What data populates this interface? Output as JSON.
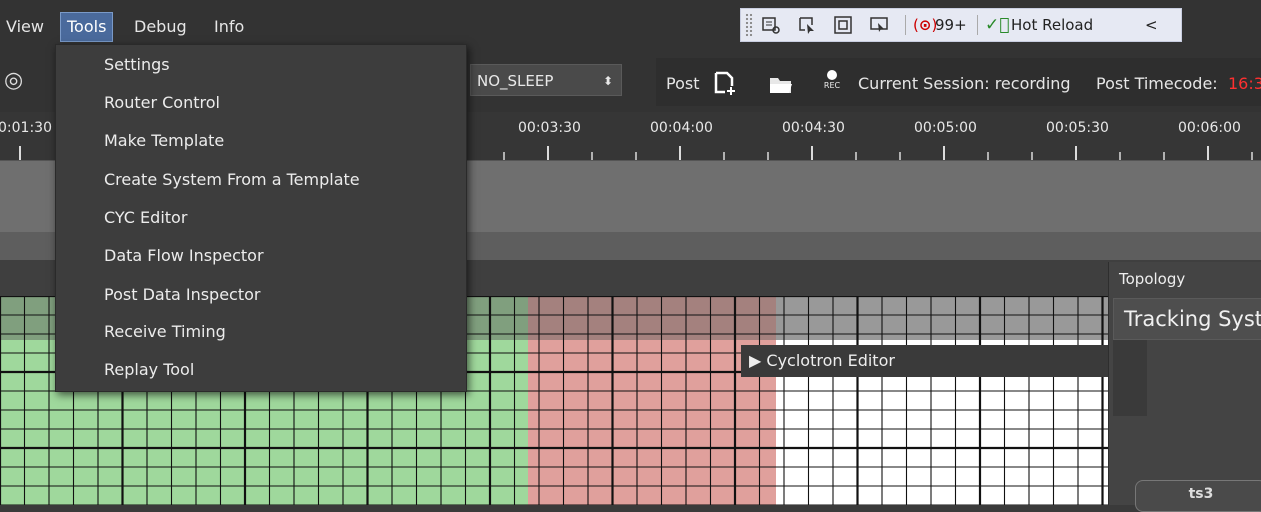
{
  "menubar": {
    "items": [
      "View",
      "Tools",
      "Debug",
      "Info"
    ]
  },
  "tools_menu": {
    "items": [
      "Settings",
      "Router Control",
      "Make Template",
      "Create System From a Template",
      "CYC Editor",
      "Data Flow Inspector",
      "Post Data Inspector",
      "Receive Timing",
      "Replay Tool"
    ]
  },
  "debug_toolbar": {
    "icons": [
      "select-element-icon",
      "pointer-icon",
      "frame-icon",
      "snapshot-icon"
    ],
    "error_badge": "99+",
    "hot_reload": "Hot Reload",
    "collapse": "<"
  },
  "toolbar": {
    "sleep_mode": "NO_SLEEP",
    "post_label": "Post",
    "rec_label": "REC",
    "session_status": "Current Session: recording",
    "post_timecode_label": "Post Timecode:",
    "post_timecode_value": "16:3"
  },
  "timeline": {
    "tick_labels": [
      "0:01:30",
      "00:03:30",
      "00:04:00",
      "00:04:30",
      "00:05:00",
      "00:05:30",
      "00:06:00"
    ]
  },
  "cyclotron_editor": {
    "label": "Cyclotron Editor"
  },
  "topology": {
    "title": "Topology",
    "system_name": "Tracking Syst",
    "ts_button": "ts3"
  },
  "colors": {
    "green_zone": "#9fd89c",
    "red_zone": "#e0a09c",
    "menu_highlight": "#4a6a9c",
    "timecode_red": "#ff3030"
  }
}
